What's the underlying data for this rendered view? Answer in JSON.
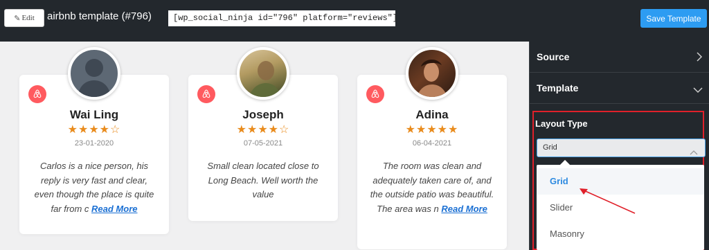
{
  "header": {
    "edit_label": "Edit",
    "template_title": "airbnb template (#796)",
    "shortcode": "[wp_social_ninja id=\"796\" platform=\"reviews\"]",
    "save_label": "Save Template"
  },
  "reviews": [
    {
      "name": "Wai Ling",
      "stars": "★★★★☆",
      "rating": 4,
      "date": "23-01-2020",
      "text": "Carlos is a nice person, his reply is very fast and clear, even though the place is quite far from c",
      "read_more": "Read More"
    },
    {
      "name": "Joseph",
      "stars": "★★★★☆",
      "rating": 4,
      "date": "07-05-2021",
      "text": "Small clean located close to Long Beach. Well worth the value",
      "read_more": ""
    },
    {
      "name": "Adina",
      "stars": "★★★★★",
      "rating": 5,
      "date": "06-04-2021",
      "text": "The room was clean and adequately taken care of, and the outside patio was beautiful. The area was n",
      "read_more": "Read More"
    }
  ],
  "sidebar": {
    "source_label": "Source",
    "template_label": "Template",
    "layout_type_label": "Layout Type",
    "selected_value": "Grid",
    "options": [
      "Grid",
      "Slider",
      "Masonry"
    ]
  },
  "colors": {
    "accent": "#2d9cf2",
    "airbnb": "#ff5a5f",
    "star": "#e98b1c",
    "highlight_box": "#e0202a",
    "arrow": "#e0202a"
  },
  "icons": [
    "pencil-icon",
    "airbnb-icon",
    "chevron-right-icon",
    "chevron-down-icon",
    "chevron-up-icon"
  ]
}
